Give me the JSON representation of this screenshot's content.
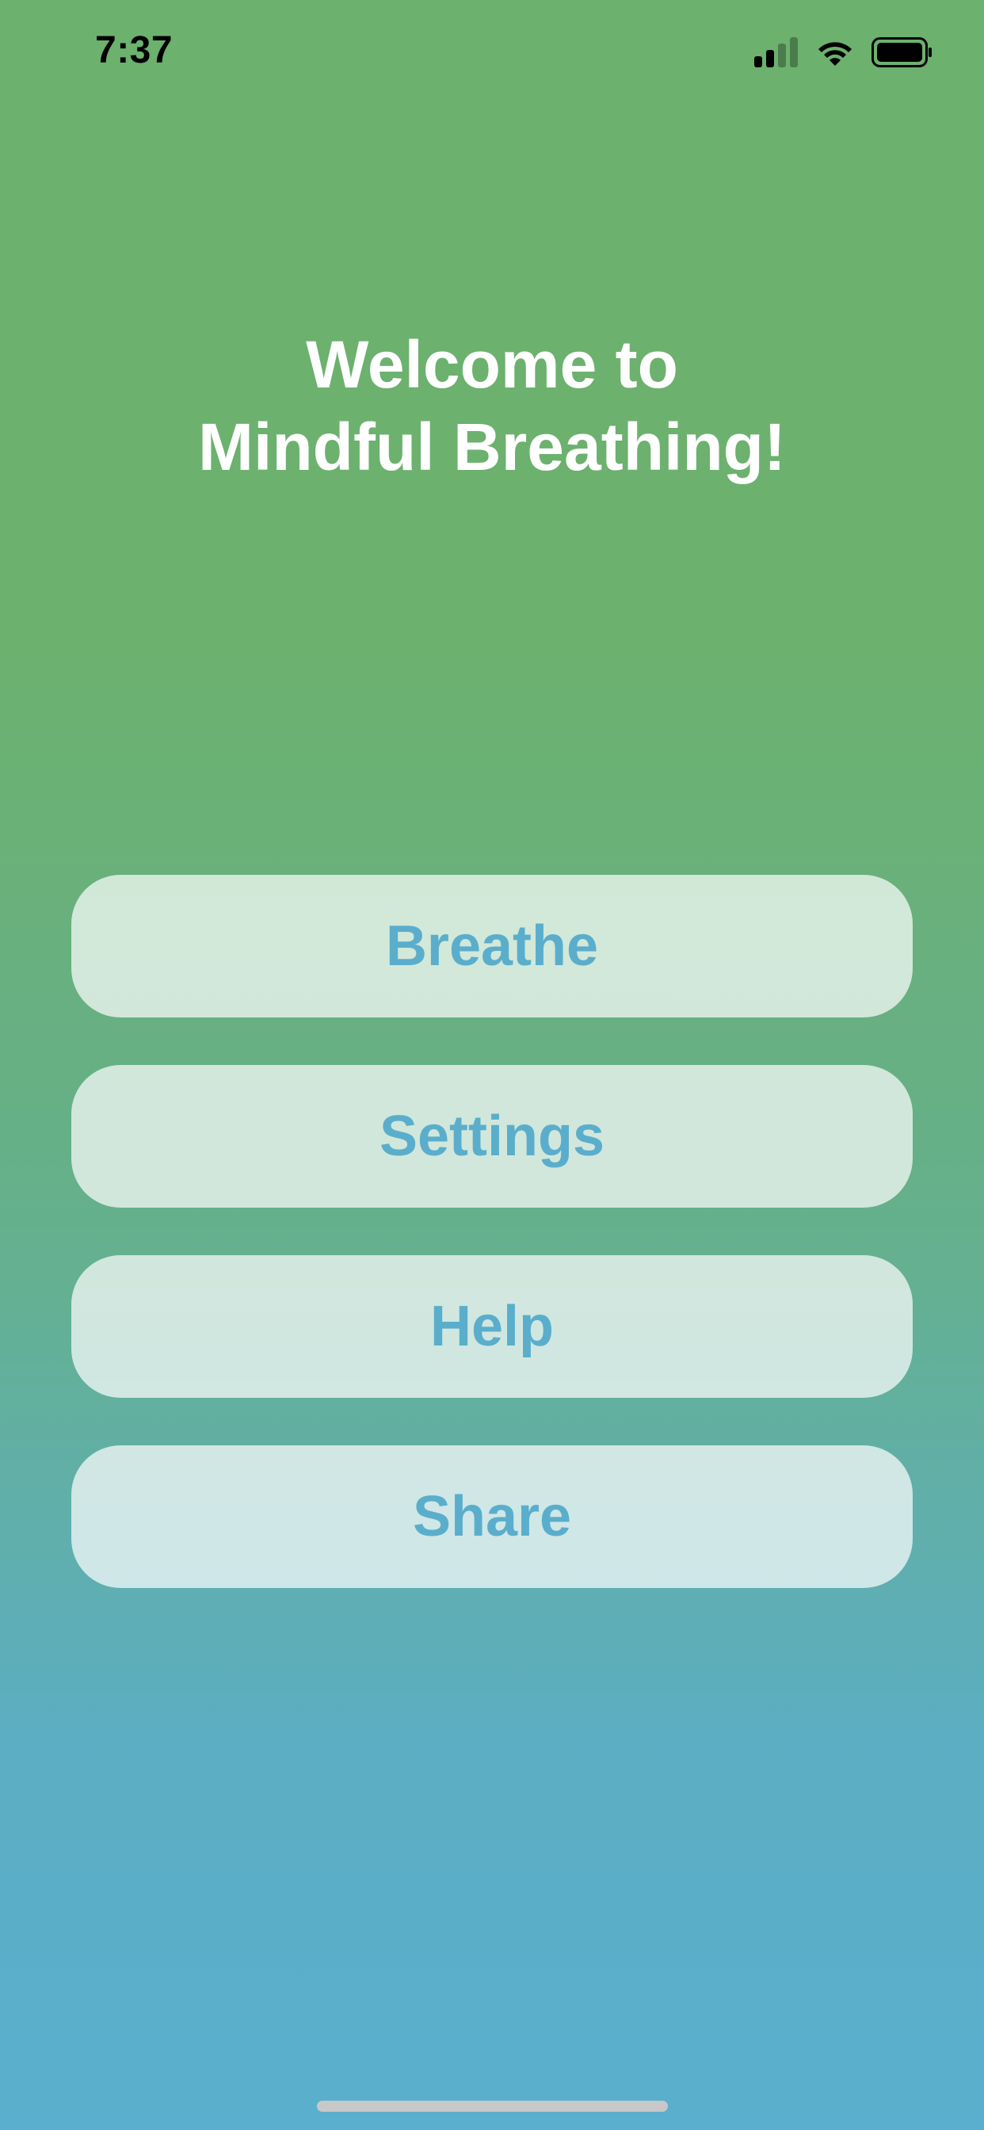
{
  "status_bar": {
    "time": "7:37",
    "signal_icon": "cellular-signal-icon",
    "wifi_icon": "wifi-icon",
    "battery_icon": "battery-icon"
  },
  "welcome": {
    "line1": "Welcome to",
    "line2": "Mindful Breathing!"
  },
  "menu": {
    "breathe_label": "Breathe",
    "settings_label": "Settings",
    "help_label": "Help",
    "share_label": "Share"
  },
  "colors": {
    "gradient_top": "#6cb16e",
    "gradient_bottom": "#5aafce",
    "button_text": "#5aaecc",
    "button_background": "rgba(255,255,255,0.7)",
    "title_text": "#ffffff"
  }
}
